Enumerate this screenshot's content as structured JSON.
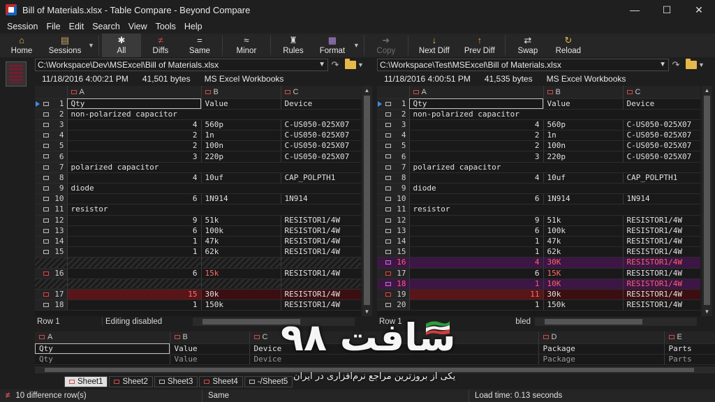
{
  "window": {
    "title": "Bill of Materials.xlsx - Table Compare - Beyond Compare",
    "controls": [
      "—",
      "☐",
      "✕"
    ]
  },
  "menu": [
    "Session",
    "File",
    "Edit",
    "Search",
    "View",
    "Tools",
    "Help"
  ],
  "toolbar": {
    "home": "Home",
    "sessions": "Sessions",
    "all": "All",
    "diffs": "Diffs",
    "same": "Same",
    "minor": "Minor",
    "rules": "Rules",
    "format": "Format",
    "copy": "Copy",
    "next_diff": "Next Diff",
    "prev_diff": "Prev Diff",
    "swap": "Swap",
    "reload": "Reload"
  },
  "left": {
    "path": "C:\\Workspace\\Dev\\MSExcel\\Bill of Materials.xlsx",
    "date": "11/18/2016 4:00:21 PM",
    "size": "41,501 bytes",
    "format": "MS Excel Workbooks",
    "columns": [
      "A",
      "B",
      "C"
    ],
    "status_row": "Row 1",
    "status_edit": "Editing disabled",
    "rows": [
      {
        "n": "1",
        "a": "Qty",
        "b": "Value",
        "c": "Device",
        "t": "cur"
      },
      {
        "n": "2",
        "a": "non-polarized capacitor",
        "b": "",
        "c": "",
        "t": "span"
      },
      {
        "n": "3",
        "a": "4",
        "b": "560p",
        "c": "C-US050-025X07",
        "t": "num"
      },
      {
        "n": "4",
        "a": "2",
        "b": "1n",
        "c": "C-US050-025X07",
        "t": "num"
      },
      {
        "n": "5",
        "a": "2",
        "b": "100n",
        "c": "C-US050-025X07",
        "t": "num"
      },
      {
        "n": "6",
        "a": "3",
        "b": "220p",
        "c": "C-US050-025X07",
        "t": "num"
      },
      {
        "n": "7",
        "a": "polarized capacitor",
        "b": "",
        "c": "",
        "t": "span"
      },
      {
        "n": "8",
        "a": "4",
        "b": "10uf",
        "c": "CAP_POLPTH1",
        "t": "num"
      },
      {
        "n": "9",
        "a": "diode",
        "b": "",
        "c": "",
        "t": "span"
      },
      {
        "n": "10",
        "a": "6",
        "b": "1N914",
        "c": "1N914",
        "t": "num"
      },
      {
        "n": "11",
        "a": "resistor",
        "b": "",
        "c": "",
        "t": "span"
      },
      {
        "n": "12",
        "a": "9",
        "b": "51k",
        "c": "RESISTOR1/4W",
        "t": "num"
      },
      {
        "n": "13",
        "a": "6",
        "b": "100k",
        "c": "RESISTOR1/4W",
        "t": "num"
      },
      {
        "n": "14",
        "a": "1",
        "b": "47k",
        "c": "RESISTOR1/4W",
        "t": "num"
      },
      {
        "n": "15",
        "a": "1",
        "b": "62k",
        "c": "RESISTOR1/4W",
        "t": "num"
      },
      {
        "n": "",
        "a": "",
        "b": "",
        "c": "",
        "t": "missing"
      },
      {
        "n": "16",
        "a": "6",
        "b": "15k",
        "c": "RESISTOR1/4W",
        "t": "partial"
      },
      {
        "n": "",
        "a": "",
        "b": "",
        "c": "",
        "t": "missing"
      },
      {
        "n": "17",
        "a": "15",
        "b": "30k",
        "c": "RESISTOR1/4W",
        "t": "diff"
      },
      {
        "n": "18",
        "a": "1",
        "b": "150k",
        "c": "RESISTOR1/4W",
        "t": "num"
      }
    ]
  },
  "right": {
    "path": "C:\\Workspace\\Test\\MSExcel\\Bill of Materials.xlsx",
    "date": "11/18/2016 4:00:51 PM",
    "size": "41,535 bytes",
    "format": "MS Excel Workbooks",
    "columns": [
      "A",
      "B",
      "C"
    ],
    "status_row": "Row 1",
    "status_edit": "bled",
    "rows": [
      {
        "n": "1",
        "a": "Qty",
        "b": "Value",
        "c": "Device",
        "t": "cur"
      },
      {
        "n": "2",
        "a": "non-polarized capacitor",
        "b": "",
        "c": "",
        "t": "span"
      },
      {
        "n": "3",
        "a": "4",
        "b": "560p",
        "c": "C-US050-025X07",
        "t": "num"
      },
      {
        "n": "4",
        "a": "2",
        "b": "1n",
        "c": "C-US050-025X07",
        "t": "num"
      },
      {
        "n": "5",
        "a": "2",
        "b": "100n",
        "c": "C-US050-025X07",
        "t": "num"
      },
      {
        "n": "6",
        "a": "3",
        "b": "220p",
        "c": "C-US050-025X07",
        "t": "num"
      },
      {
        "n": "7",
        "a": "polarized capacitor",
        "b": "",
        "c": "",
        "t": "span"
      },
      {
        "n": "8",
        "a": "4",
        "b": "10uf",
        "c": "CAP_POLPTH1",
        "t": "num"
      },
      {
        "n": "9",
        "a": "diode",
        "b": "",
        "c": "",
        "t": "span"
      },
      {
        "n": "10",
        "a": "6",
        "b": "1N914",
        "c": "1N914",
        "t": "num"
      },
      {
        "n": "11",
        "a": "resistor",
        "b": "",
        "c": "",
        "t": "span"
      },
      {
        "n": "12",
        "a": "9",
        "b": "51k",
        "c": "RESISTOR1/4W",
        "t": "num"
      },
      {
        "n": "13",
        "a": "6",
        "b": "100k",
        "c": "RESISTOR1/4W",
        "t": "num"
      },
      {
        "n": "14",
        "a": "1",
        "b": "47k",
        "c": "RESISTOR1/4W",
        "t": "num"
      },
      {
        "n": "15",
        "a": "1",
        "b": "62k",
        "c": "RESISTOR1/4W",
        "t": "num"
      },
      {
        "n": "16",
        "a": "4",
        "b": "30K",
        "c": "RESISTOR1/4W",
        "t": "ins"
      },
      {
        "n": "17",
        "a": "6",
        "b": "15K",
        "c": "RESISTOR1/4W",
        "t": "partial"
      },
      {
        "n": "18",
        "a": "1",
        "b": "10K",
        "c": "RESISTOR1/4W",
        "t": "ins"
      },
      {
        "n": "19",
        "a": "11",
        "b": "30k",
        "c": "RESISTOR1/4W",
        "t": "diff"
      },
      {
        "n": "20",
        "a": "1",
        "b": "150k",
        "c": "RESISTOR1/4W",
        "t": "num"
      }
    ]
  },
  "detail": {
    "columns": [
      "A",
      "B",
      "C",
      "D",
      "E"
    ],
    "row1": [
      "Qty",
      "Value",
      "Device",
      "Package",
      "Parts"
    ],
    "row2": [
      "Qty",
      "Value",
      "Device",
      "Package",
      "Parts"
    ]
  },
  "sheets": [
    "Sheet1",
    "Sheet2",
    "Sheet3",
    "Sheet4",
    "-/Sheet5"
  ],
  "status": {
    "diffs": "10 difference row(s)",
    "same": "Same",
    "load": "Load time: 0.13 seconds"
  },
  "watermark": {
    "title": "سافت ۹۸",
    "subtitle": "یکی از بروزترین مراجع نرم‌افزاری در ایران"
  },
  "colors": {
    "diff_red": "#5a1518",
    "inserted_purple": "#3c1644",
    "accent_blue": "#3a8ee6"
  }
}
